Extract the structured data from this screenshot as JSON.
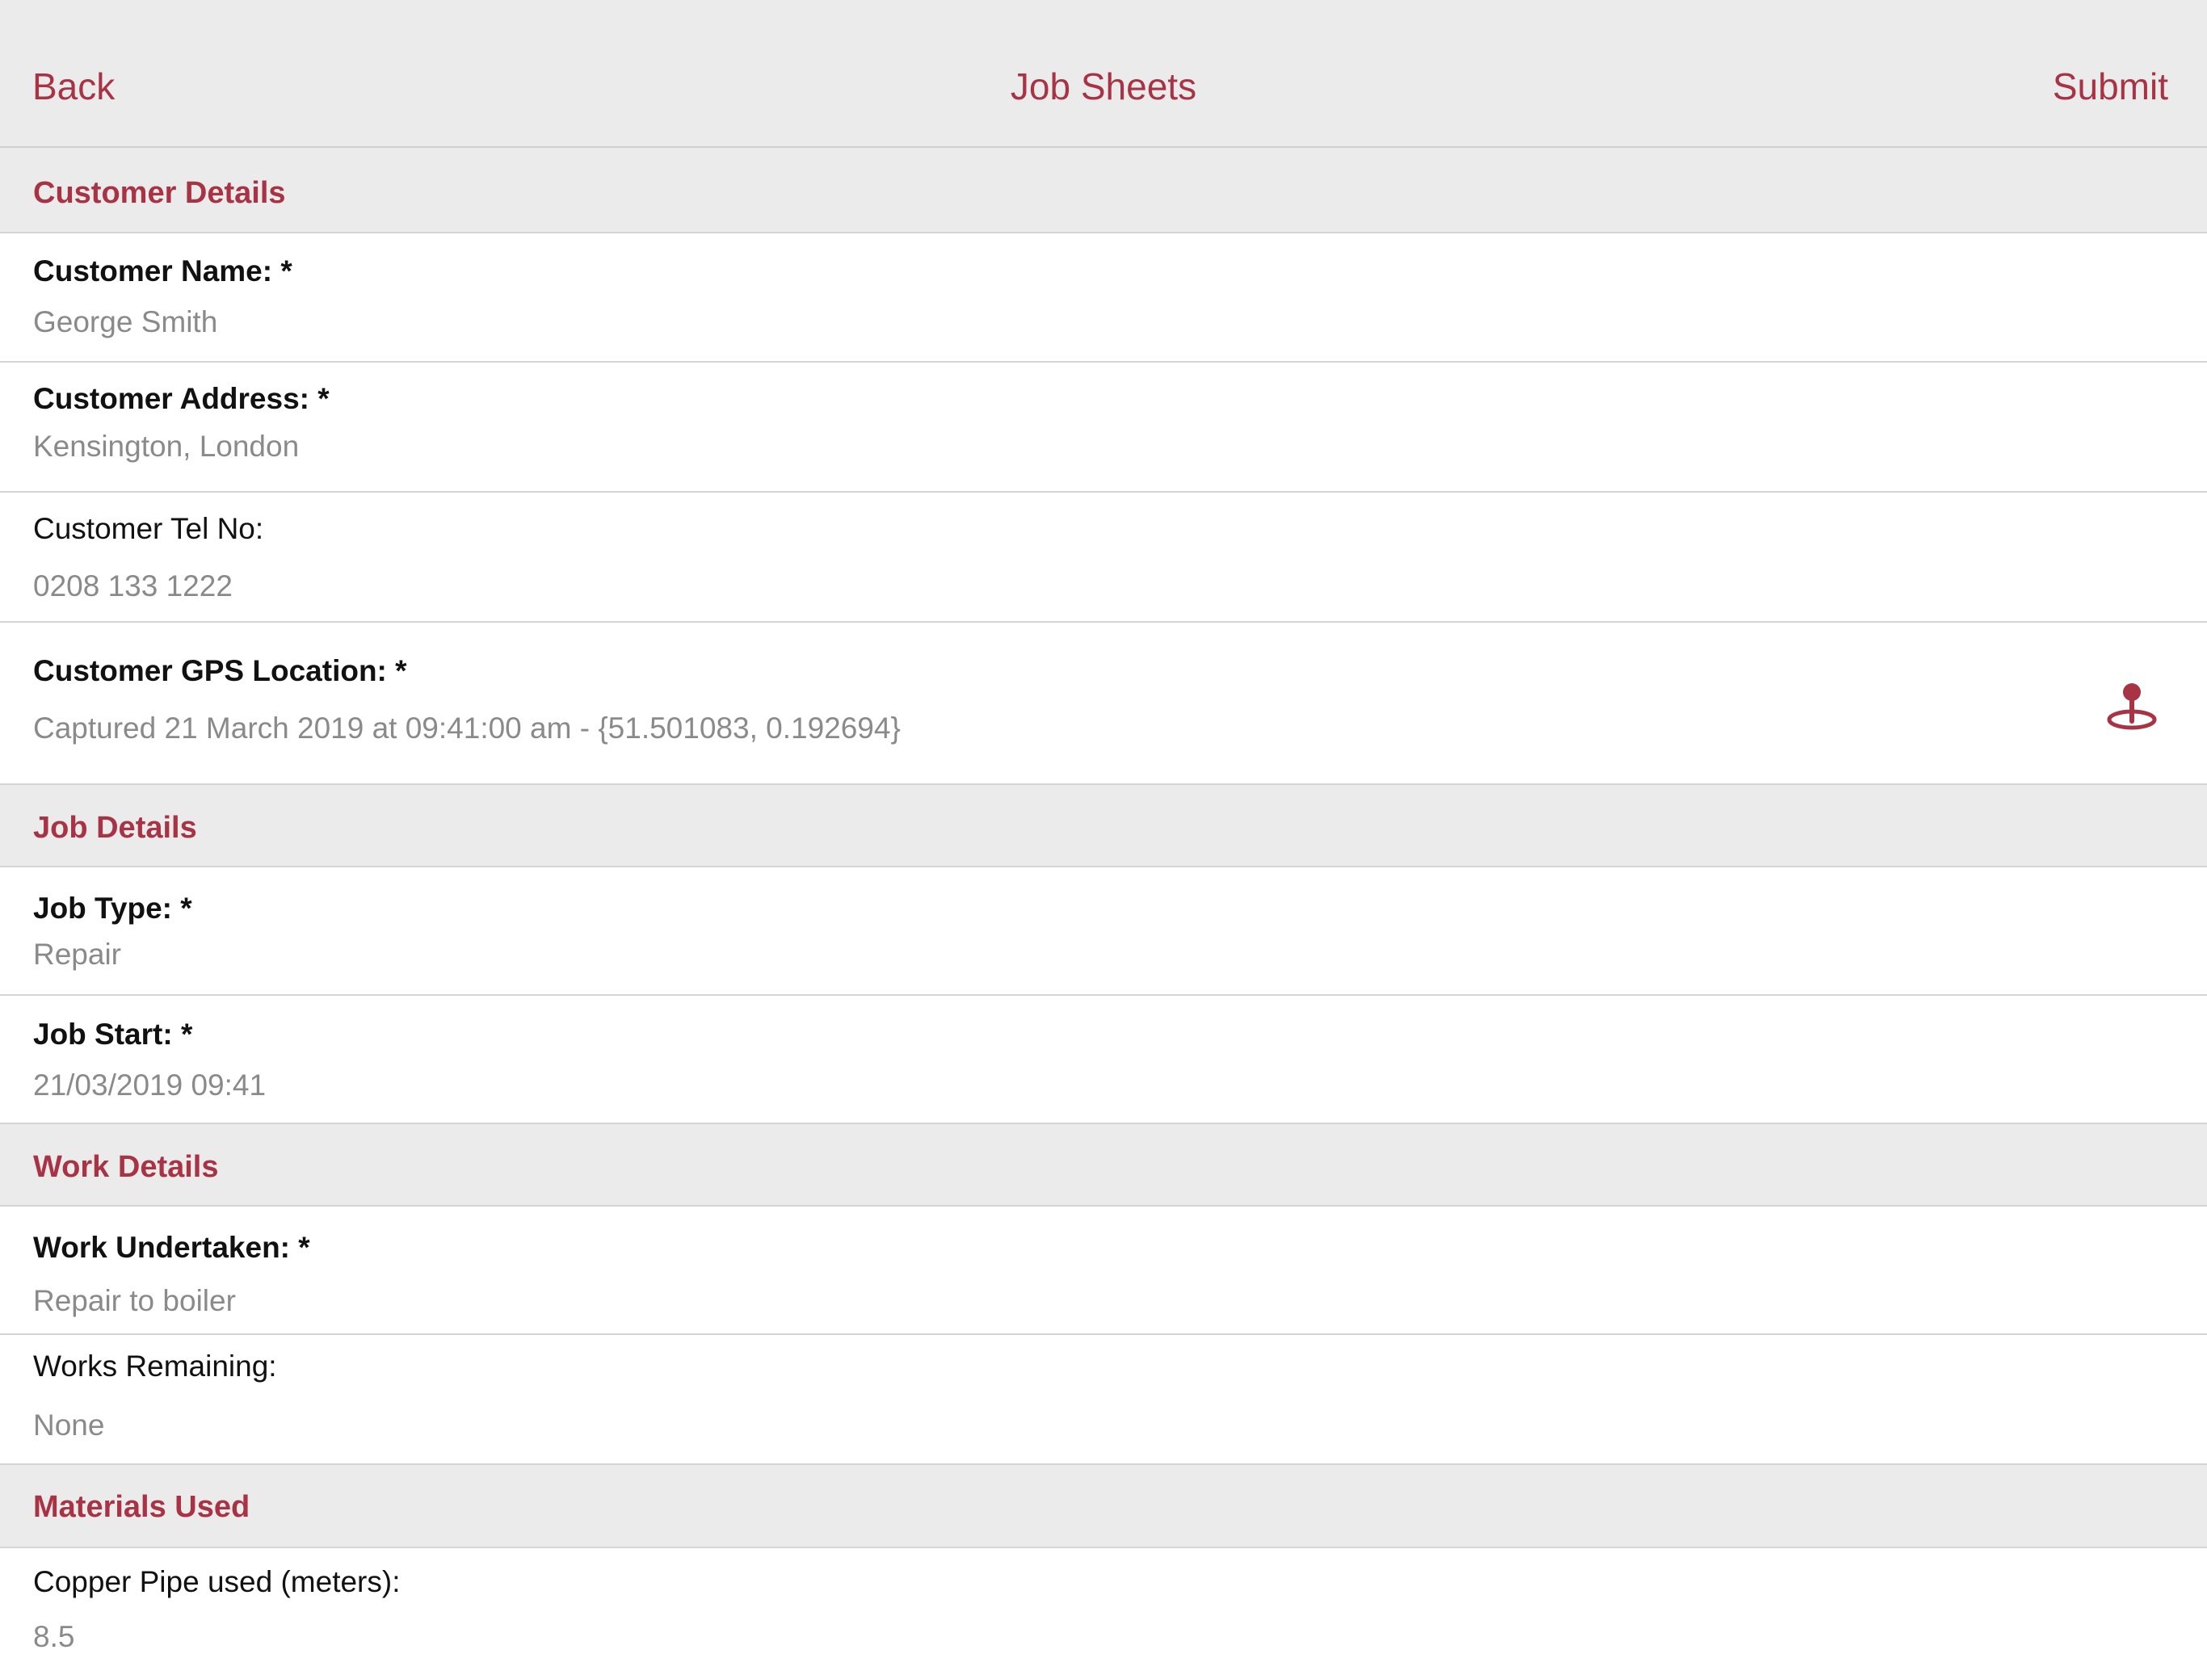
{
  "nav": {
    "back_label": "Back",
    "title": "Job Sheets",
    "submit_label": "Submit"
  },
  "sections": {
    "customer": {
      "title": "Customer Details",
      "name_label": "Customer Name: *",
      "name_value": "George Smith",
      "address_label": "Customer Address: *",
      "address_value": "Kensington, London",
      "tel_label": "Customer Tel No:",
      "tel_value": "0208 133 1222",
      "gps_label": "Customer GPS Location: *",
      "gps_value": "Captured 21 March 2019 at 09:41:00 am - {51.501083, 0.192694}",
      "gps_icon": "map-pin-icon"
    },
    "job": {
      "title": "Job Details",
      "type_label": "Job Type: *",
      "type_value": "Repair",
      "start_label": "Job Start: *",
      "start_value": "21/03/2019 09:41"
    },
    "work": {
      "title": "Work Details",
      "undertaken_label": "Work Undertaken: *",
      "undertaken_value": "Repair to boiler",
      "remaining_label": "Works Remaining:",
      "remaining_value": "None"
    },
    "materials": {
      "title": "Materials Used",
      "copper_label": "Copper Pipe used (meters):",
      "copper_value": "8.5"
    }
  },
  "colors": {
    "accent": "#a83345",
    "header_bg": "#ebebeb",
    "value_text": "#8a8a8a"
  }
}
